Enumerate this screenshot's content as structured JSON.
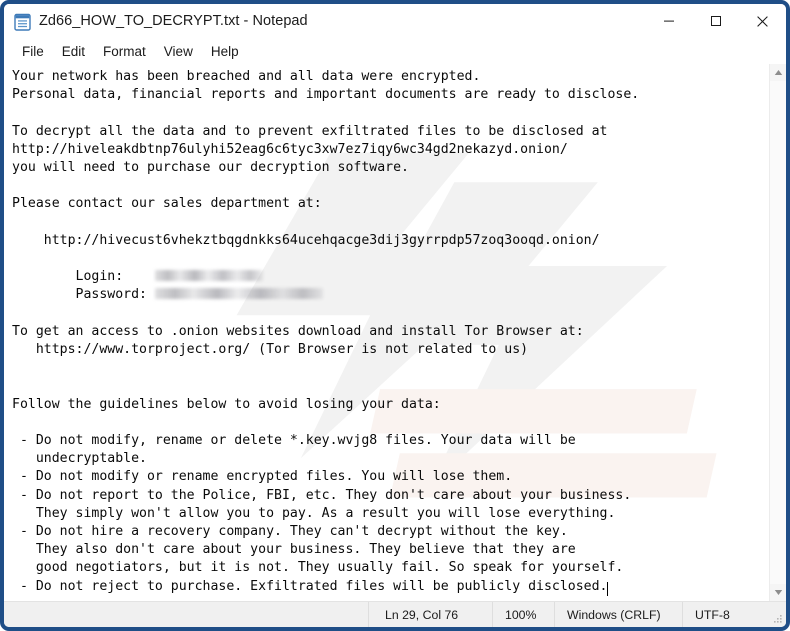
{
  "window": {
    "title": "Zd66_HOW_TO_DECRYPT.txt - Notepad",
    "icon": "notepad-icon",
    "controls": {
      "minimize": "minimize-icon",
      "maximize": "maximize-icon",
      "close": "close-icon"
    },
    "border_color": "#1f4e87"
  },
  "menu": {
    "items": [
      {
        "label": "File"
      },
      {
        "label": "Edit"
      },
      {
        "label": "Format"
      },
      {
        "label": "View"
      },
      {
        "label": "Help"
      }
    ]
  },
  "editor": {
    "line1": "Your network has been breached and all data were encrypted.",
    "line2": "Personal data, financial reports and important documents are ready to disclose.",
    "line3": "",
    "line4": "To decrypt all the data and to prevent exfiltrated files to be disclosed at",
    "line5": "http://hiveleakdbtnp76ulyhi52eag6c6tyc3xw7ez7iqy6wc34gd2nekazyd.onion/",
    "line6": "you will need to purchase our decryption software.",
    "line7": "",
    "line8": "Please contact our sales department at:",
    "line9": "",
    "line10": "    http://hivecust6vhekztbqgdnkks64ucehqacge3dij3gyrrpdp57zoq3ooqd.onion/",
    "line11": "",
    "login_label": "        Login:    ",
    "login_value_redacted": "",
    "password_label": "        Password: ",
    "password_value_redacted": "",
    "line14": "",
    "line15": "To get an access to .onion websites download and install Tor Browser at:",
    "line16": "   https://www.torproject.org/ (Tor Browser is not related to us)",
    "line17": "",
    "line18": "",
    "line19": "Follow the guidelines below to avoid losing your data:",
    "line20": "",
    "line21": " - Do not modify, rename or delete *.key.wvjg8 files. Your data will be",
    "line22": "   undecryptable.",
    "line23": " - Do not modify or rename encrypted files. You will lose them.",
    "line24": " - Do not report to the Police, FBI, etc. They don't care about your business.",
    "line25": "   They simply won't allow you to pay. As a result you will lose everything.",
    "line26": " - Do not hire a recovery company. They can't decrypt without the key.",
    "line27": "   They also don't care about your business. They believe that they are",
    "line28": "   good negotiators, but it is not. They usually fail. So speak for yourself.",
    "line29": " - Do not reject to purchase. Exfiltrated files will be publicly disclosed."
  },
  "scrollbar": {
    "up_arrow": "scroll-up-icon",
    "down_arrow": "scroll-down-icon"
  },
  "status_bar": {
    "cursor_position": "Ln 29, Col 76",
    "zoom": "100%",
    "line_ending": "Windows (CRLF)",
    "encoding": "UTF-8"
  }
}
